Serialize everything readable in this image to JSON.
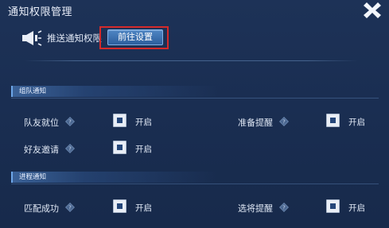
{
  "window": {
    "title": "通知权限管理"
  },
  "push": {
    "label": "推送通知权限",
    "button_label": "前往设置"
  },
  "sections": [
    {
      "title": "组队通知",
      "options": [
        {
          "label": "队友就位",
          "state": "开启"
        },
        {
          "label": "准备提醒",
          "state": "开启"
        },
        {
          "label": "好友邀请",
          "state": "开启"
        }
      ]
    },
    {
      "title": "进程通知",
      "options": [
        {
          "label": "匹配成功",
          "state": "开启"
        },
        {
          "label": "选将提醒",
          "state": "开启"
        }
      ]
    }
  ],
  "colors": {
    "highlight_frame": "#d42a2a",
    "accent": "#3a6fb0",
    "background": "#1b3053"
  },
  "icons": [
    "close-icon",
    "speaker-icon",
    "help-icon"
  ]
}
